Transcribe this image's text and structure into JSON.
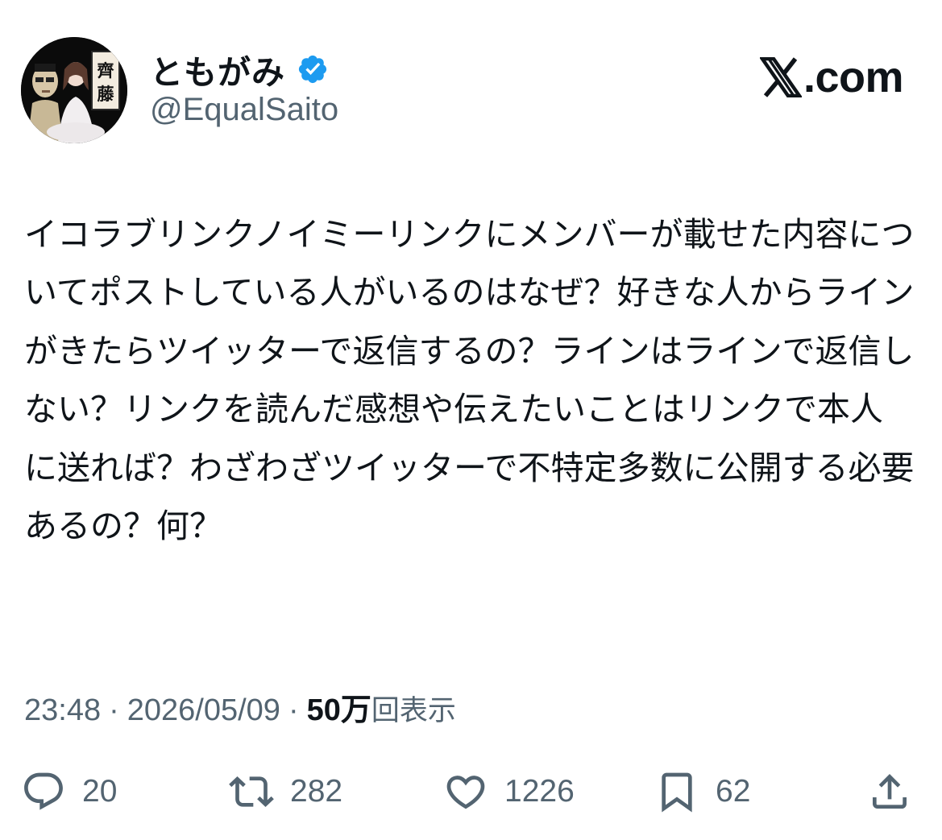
{
  "author": {
    "display_name": "ともがみ",
    "handle": "@EqualSaito",
    "verified": true,
    "avatar_sign": [
      "齊",
      "藤"
    ]
  },
  "brand": {
    "logo_icon": "x-logo-icon",
    "text": ".com"
  },
  "post": {
    "text": "イコラブリンクノイミーリンクにメンバーが載せた内容についてポストしている人がいるのはなぜ？好きな人からラインがきたらツイッターで返信するの？ラインはラインで返信しない？リンクを読んだ感想や伝えたいことはリンクで本人に送れば？わざわざツイッターで不特定多数に公開する必要あるの？何？"
  },
  "meta": {
    "time": "23:48",
    "separator": "·",
    "date": "2026/05/09",
    "views_count": "50万",
    "views_label": "回表示"
  },
  "actions": {
    "reply": {
      "icon": "reply-icon",
      "count": "20"
    },
    "repost": {
      "icon": "repost-icon",
      "count": "282"
    },
    "like": {
      "icon": "heart-icon",
      "count": "1226"
    },
    "bookmark": {
      "icon": "bookmark-icon",
      "count": "62"
    },
    "share": {
      "icon": "share-icon"
    }
  },
  "colors": {
    "text_primary": "#0f1419",
    "text_secondary": "#536471",
    "verified_blue": "#1d9bf0"
  }
}
